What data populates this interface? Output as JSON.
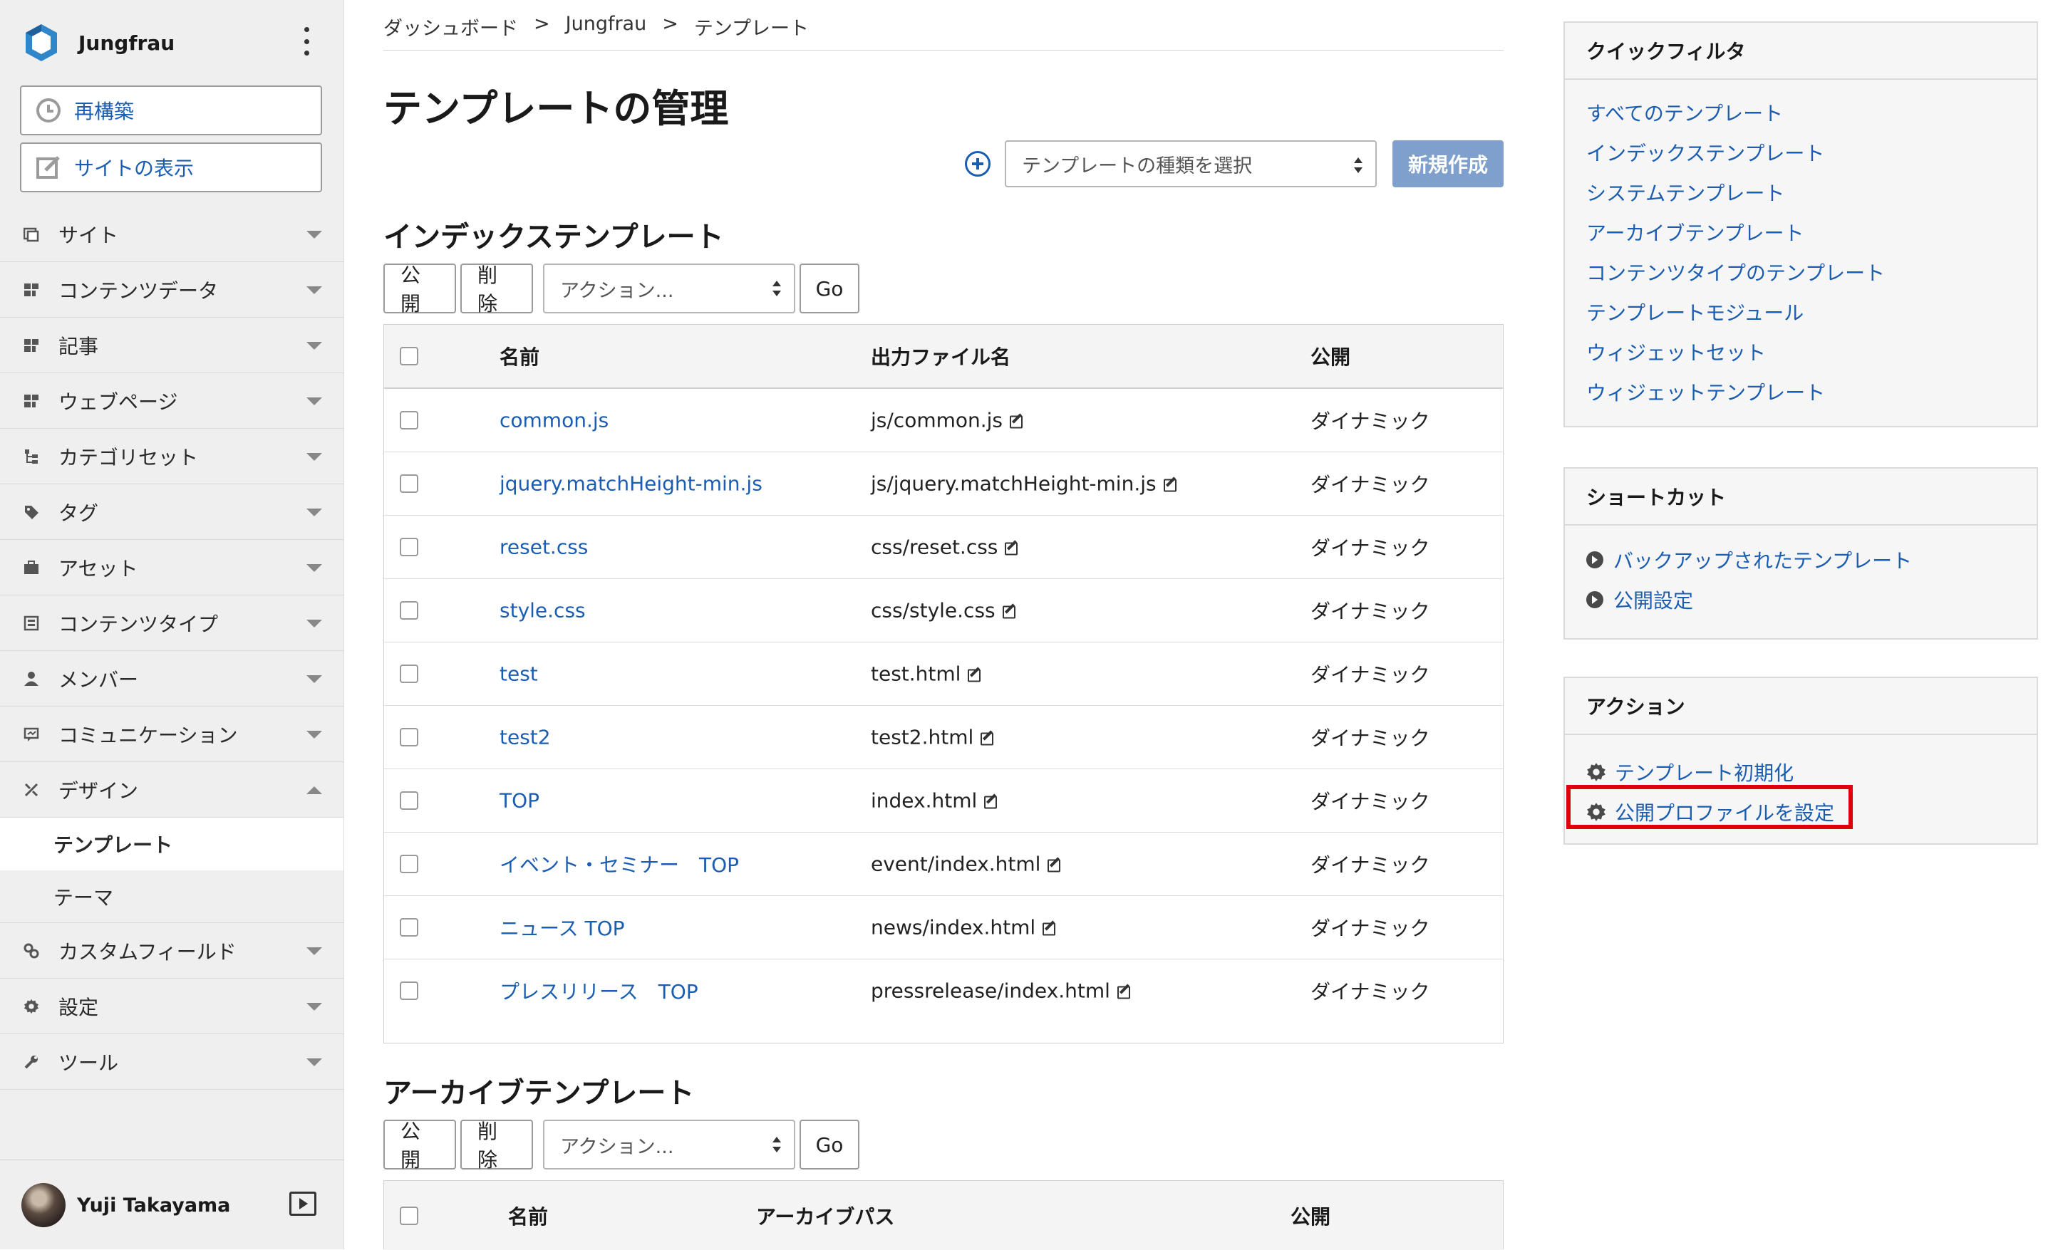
{
  "sidebar": {
    "brand": "Jungfrau",
    "rebuild_label": "再構築",
    "view_site_label": "サイトの表示",
    "nav": [
      {
        "label": "サイト",
        "icon": "site-icon"
      },
      {
        "label": "コンテンツデータ",
        "icon": "content-data-icon"
      },
      {
        "label": "記事",
        "icon": "entry-icon"
      },
      {
        "label": "ウェブページ",
        "icon": "webpage-icon"
      },
      {
        "label": "カテゴリセット",
        "icon": "category-set-icon"
      },
      {
        "label": "タグ",
        "icon": "tag-icon"
      },
      {
        "label": "アセット",
        "icon": "asset-icon"
      },
      {
        "label": "コンテンツタイプ",
        "icon": "content-type-icon"
      },
      {
        "label": "メンバー",
        "icon": "member-icon"
      },
      {
        "label": "コミュニケーション",
        "icon": "communication-icon"
      },
      {
        "label": "デザイン",
        "icon": "design-icon"
      }
    ],
    "design_sub": [
      "テンプレート",
      "テーマ"
    ],
    "nav_after": [
      {
        "label": "カスタムフィールド",
        "icon": "custom-field-icon"
      },
      {
        "label": "設定",
        "icon": "settings-icon"
      },
      {
        "label": "ツール",
        "icon": "tools-icon"
      }
    ],
    "user_name": "Yuji Takayama"
  },
  "breadcrumb": [
    "ダッシュボード",
    ">",
    "Jungfrau",
    ">",
    "テンプレート"
  ],
  "page_title": "テンプレートの管理",
  "toolbar": {
    "type_select": "テンプレートの種類を選択",
    "create_label": "新規作成"
  },
  "index_section": {
    "title": "インデックステンプレート",
    "publish_label": "公開",
    "delete_label": "削除",
    "action_select": "アクション...",
    "go_label": "Go",
    "headers": {
      "name": "名前",
      "output": "出力ファイル名",
      "publish": "公開"
    },
    "rows": [
      {
        "name": "common.js",
        "file": "js/common.js",
        "publish": "ダイナミック"
      },
      {
        "name": "jquery.matchHeight-min.js",
        "file": "js/jquery.matchHeight-min.js",
        "publish": "ダイナミック"
      },
      {
        "name": "reset.css",
        "file": "css/reset.css",
        "publish": "ダイナミック"
      },
      {
        "name": "style.css",
        "file": "css/style.css",
        "publish": "ダイナミック"
      },
      {
        "name": "test",
        "file": "test.html",
        "publish": "ダイナミック"
      },
      {
        "name": "test2",
        "file": "test2.html",
        "publish": "ダイナミック"
      },
      {
        "name": "TOP",
        "file": "index.html",
        "publish": "ダイナミック"
      },
      {
        "name": "イベント・セミナー　TOP",
        "file": "event/index.html",
        "publish": "ダイナミック"
      },
      {
        "name": "ニュース TOP",
        "file": "news/index.html",
        "publish": "ダイナミック"
      },
      {
        "name": "プレスリリース　TOP",
        "file": "pressrelease/index.html",
        "publish": "ダイナミック"
      }
    ]
  },
  "archive_section": {
    "title": "アーカイブテンプレート",
    "publish_label": "公開",
    "delete_label": "削除",
    "action_select": "アクション...",
    "go_label": "Go",
    "headers": {
      "name": "名前",
      "path": "アーカイブパス",
      "publish": "公開"
    }
  },
  "quick_filter": {
    "title": "クイックフィルタ",
    "items": [
      "すべてのテンプレート",
      "インデックステンプレート",
      "システムテンプレート",
      "アーカイブテンプレート",
      "コンテンツタイプのテンプレート",
      "テンプレートモジュール",
      "ウィジェットセット",
      "ウィジェットテンプレート"
    ]
  },
  "shortcuts": {
    "title": "ショートカット",
    "items": [
      "バックアップされたテンプレート",
      "公開設定"
    ]
  },
  "actions": {
    "title": "アクション",
    "items": [
      "テンプレート初期化",
      "公開プロファイルを設定"
    ]
  },
  "colors": {
    "link": "#1b5db0",
    "primary_button": "#7f9fcc",
    "highlight": "#e0000b"
  }
}
